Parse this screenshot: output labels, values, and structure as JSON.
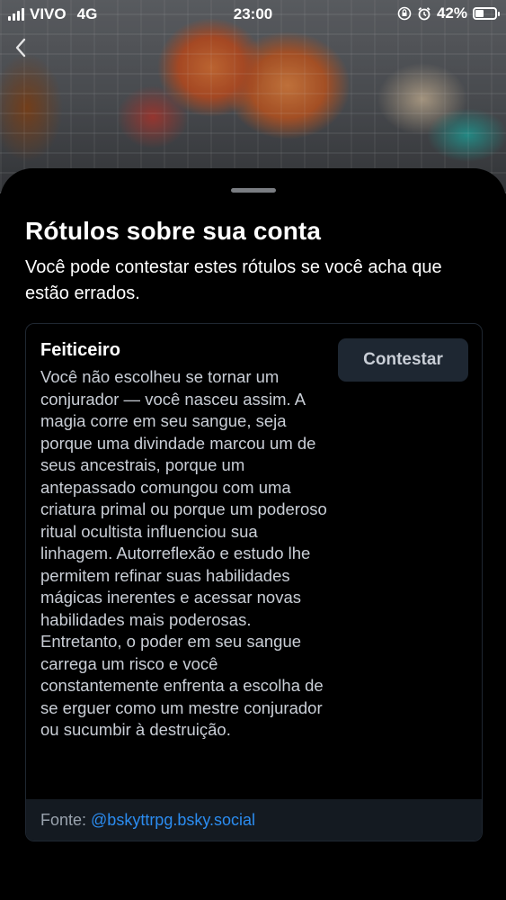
{
  "status_bar": {
    "carrier": "VIVO",
    "network": "4G",
    "time": "23:00",
    "battery_percent": "42%",
    "battery_level": 0.42,
    "icons": [
      "signal-icon",
      "orientation-lock-icon",
      "alarm-icon",
      "battery-icon"
    ]
  },
  "navigation": {
    "back_icon": "chevron-left-icon"
  },
  "sheet": {
    "title": "Rótulos sobre sua conta",
    "subtitle": "Você pode contestar estes rótulos se você acha que estão errados."
  },
  "labels": [
    {
      "name": "Feiticeiro",
      "description": "Você não escolheu se tornar um conjurador — você nasceu assim. A magia corre em seu sangue, seja porque uma divindade marcou um de seus ancestrais, porque um antepassado comungou com uma criatura primal ou porque um poderoso ritual ocultista influenciou sua linhagem. Autorreflexão e estudo lhe permitem refinar suas habilidades mágicas inerentes e acessar novas habilidades mais poderosas. Entretanto, o poder em seu sangue carrega um risco e você constantemente enfrenta a escolha de se erguer como um mestre conjurador ou sucumbir à destruição.",
      "appeal_label": "Contestar",
      "source_label": "Fonte:",
      "source_handle": "@bskyttrpg.bsky.social"
    }
  ],
  "colors": {
    "background": "#000000",
    "card_border": "#1f2731",
    "button_bg": "#1e2732",
    "footer_bg": "#141a21",
    "link": "#2b8cf0",
    "secondary_text": "#c9ced6"
  }
}
